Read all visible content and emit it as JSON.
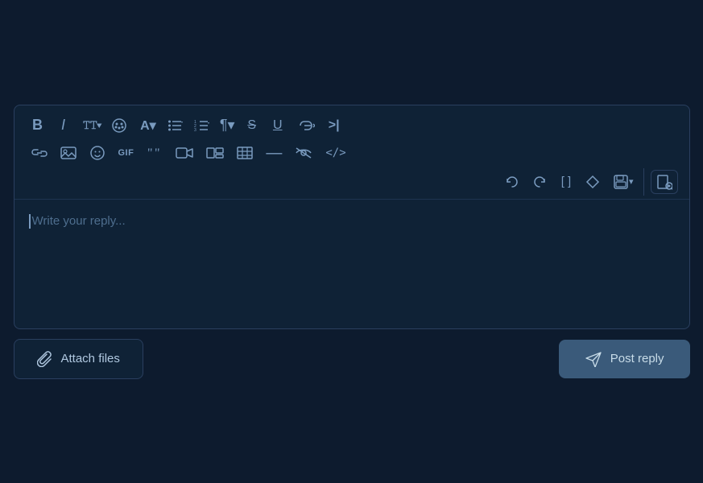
{
  "toolbar": {
    "row1": [
      {
        "name": "bold",
        "symbol": "𝐁",
        "label": "Bold"
      },
      {
        "name": "italic",
        "symbol": "𝘐",
        "label": "Italic"
      },
      {
        "name": "font-size",
        "symbol": "𝚃𝚃▾",
        "label": "Font Size"
      },
      {
        "name": "color-palette",
        "symbol": "⊕",
        "label": "Color Palette"
      },
      {
        "name": "text-color",
        "symbol": "A▾",
        "label": "Text Color"
      },
      {
        "name": "bullet-list",
        "symbol": "☰▾",
        "label": "Bullet List"
      },
      {
        "name": "ordered-list",
        "symbol": "≡▾",
        "label": "Ordered List"
      },
      {
        "name": "paragraph",
        "symbol": "¶▾",
        "label": "Paragraph"
      },
      {
        "name": "strikethrough",
        "symbol": "S̶",
        "label": "Strikethrough"
      },
      {
        "name": "underline",
        "symbol": "U̲",
        "label": "Underline"
      },
      {
        "name": "link-embed",
        "symbol": "∞",
        "label": "Link Embed"
      },
      {
        "name": "more",
        "symbol": ">|",
        "label": "More"
      }
    ],
    "row2": [
      {
        "name": "link",
        "symbol": "🔗",
        "label": "Link"
      },
      {
        "name": "image",
        "symbol": "🖼",
        "label": "Image"
      },
      {
        "name": "emoji",
        "symbol": "☺",
        "label": "Emoji"
      },
      {
        "name": "gif",
        "symbol": "GIF",
        "label": "GIF",
        "is_gif": true
      },
      {
        "name": "quote",
        "symbol": "❝",
        "label": "Quote"
      },
      {
        "name": "video",
        "symbol": "▶",
        "label": "Video"
      },
      {
        "name": "gallery",
        "symbol": "⊞",
        "label": "Gallery"
      },
      {
        "name": "table",
        "symbol": "⊟",
        "label": "Table"
      },
      {
        "name": "hr",
        "symbol": "—",
        "label": "Horizontal Rule"
      },
      {
        "name": "hidden",
        "symbol": "⊘",
        "label": "Hidden"
      },
      {
        "name": "code",
        "symbol": "</>",
        "label": "Code"
      }
    ],
    "row3": [
      {
        "name": "undo",
        "symbol": "↩",
        "label": "Undo"
      },
      {
        "name": "redo",
        "symbol": "↪",
        "label": "Redo"
      },
      {
        "name": "brackets",
        "symbol": "[ ]",
        "label": "Brackets"
      },
      {
        "name": "clear-format",
        "symbol": "◇",
        "label": "Clear Format"
      },
      {
        "name": "save",
        "symbol": "💾▾",
        "label": "Save"
      }
    ],
    "panel": {
      "name": "preview",
      "symbol": "🔍",
      "label": "Preview"
    }
  },
  "editor": {
    "placeholder": "Write your reply..."
  },
  "footer": {
    "attach_label": "Attach files",
    "post_label": "Post reply"
  }
}
